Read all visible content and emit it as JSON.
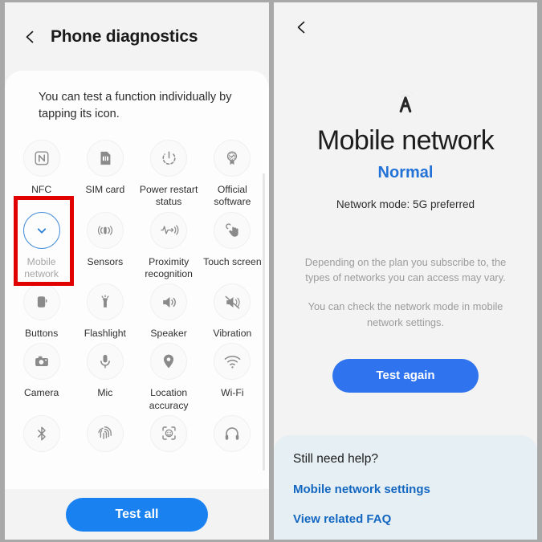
{
  "left": {
    "header": {
      "back_icon": "chevron-left-icon",
      "title": "Phone diagnostics"
    },
    "instruction": "You can test a function individually by tapping its icon.",
    "tiles": [
      {
        "label": "NFC",
        "icon": "nfc-icon",
        "state": "default"
      },
      {
        "label": "SIM card",
        "icon": "sim-card-icon",
        "state": "default"
      },
      {
        "label": "Power restart\nstatus",
        "icon": "power-restart-icon",
        "state": "default"
      },
      {
        "label": "Official\nsoftware",
        "icon": "official-software-badge-icon",
        "state": "default"
      },
      {
        "label": "Mobile\nnetwork",
        "icon": "check-circle-icon",
        "state": "tested"
      },
      {
        "label": "Sensors",
        "icon": "sensors-icon",
        "state": "default"
      },
      {
        "label": "Proximity\nrecognition",
        "icon": "proximity-icon",
        "state": "default"
      },
      {
        "label": "Touch screen",
        "icon": "touch-screen-icon",
        "state": "default"
      },
      {
        "label": "Buttons",
        "icon": "buttons-icon",
        "state": "default"
      },
      {
        "label": "Flashlight",
        "icon": "flashlight-icon",
        "state": "default"
      },
      {
        "label": "Speaker",
        "icon": "speaker-icon",
        "state": "default"
      },
      {
        "label": "Vibration",
        "icon": "vibration-icon",
        "state": "default"
      },
      {
        "label": "Camera",
        "icon": "camera-icon",
        "state": "default"
      },
      {
        "label": "Mic",
        "icon": "mic-icon",
        "state": "default"
      },
      {
        "label": "Location\naccuracy",
        "icon": "location-pin-icon",
        "state": "default"
      },
      {
        "label": "Wi-Fi",
        "icon": "wifi-icon",
        "state": "default"
      },
      {
        "label": "",
        "icon": "bluetooth-icon",
        "state": "default"
      },
      {
        "label": "",
        "icon": "fingerprint-icon",
        "state": "default"
      },
      {
        "label": "",
        "icon": "face-recognition-icon",
        "state": "default"
      },
      {
        "label": "",
        "icon": "headphones-icon",
        "state": "default"
      }
    ],
    "footer": {
      "test_all_label": "Test all"
    }
  },
  "right": {
    "header": {
      "back_icon": "chevron-left-icon"
    },
    "hero_icon": "cell-tower-icon",
    "title": "Mobile network",
    "status": "Normal",
    "network_mode": "Network mode: 5G preferred",
    "notes": [
      "Depending on the plan you subscribe to, the types of networks you can access may vary.",
      "You can check the network mode in mobile network settings."
    ],
    "test_again_label": "Test again",
    "help": {
      "title": "Still need help?",
      "links": [
        "Mobile network settings",
        "View related FAQ"
      ]
    }
  },
  "annotations": {
    "box_color": "#e00000",
    "highlighted": [
      "Mobile network tile",
      "Normal status"
    ]
  },
  "colors": {
    "primary_blue": "#1a82f0",
    "test_again_blue": "#2f74ee",
    "status_blue": "#2272d8",
    "link_blue": "#1467c0",
    "help_panel_bg": "#e6eff4",
    "panel_bg": "#f3f3f3",
    "card_bg": "#fdfdfd",
    "frame_grey": "#a8a8a8"
  }
}
